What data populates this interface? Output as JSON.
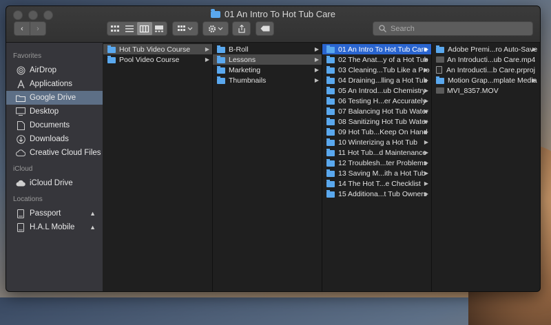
{
  "window": {
    "title": "01 An Intro To Hot Tub Care"
  },
  "toolbar": {
    "back_glyph": "‹",
    "forward_glyph": "›",
    "search_placeholder": "Search"
  },
  "sidebar": {
    "favorites_heading": "Favorites",
    "favorites": [
      {
        "label": "AirDrop",
        "icon": "airdrop-icon"
      },
      {
        "label": "Applications",
        "icon": "applications-icon"
      },
      {
        "label": "Google Drive",
        "icon": "folder-icon"
      },
      {
        "label": "Desktop",
        "icon": "desktop-icon"
      },
      {
        "label": "Documents",
        "icon": "documents-icon"
      },
      {
        "label": "Downloads",
        "icon": "downloads-icon"
      },
      {
        "label": "Creative Cloud Files",
        "icon": "creative-cloud-icon"
      }
    ],
    "icloud_heading": "iCloud",
    "icloud": [
      {
        "label": "iCloud Drive",
        "icon": "cloud-icon"
      }
    ],
    "locations_heading": "Locations",
    "locations": [
      {
        "label": "Passport",
        "icon": "drive-icon"
      },
      {
        "label": "H.A.L Mobile",
        "icon": "drive-icon"
      }
    ]
  },
  "columns": {
    "col1": [
      {
        "label": "Hot Tub Video Course"
      },
      {
        "label": "Pool Video Course"
      }
    ],
    "col2": [
      {
        "label": "B-Roll"
      },
      {
        "label": "Lessons"
      },
      {
        "label": "Marketing"
      },
      {
        "label": "Thumbnails"
      }
    ],
    "col3": [
      {
        "label": "01 An Intro To Hot Tub Care"
      },
      {
        "label": "02 The Anat...y of a Hot Tub"
      },
      {
        "label": "03 Cleaning...Tub Like a Pro"
      },
      {
        "label": "04 Draining...lling a Hot Tub"
      },
      {
        "label": "05 An Introd...ub Chemistry"
      },
      {
        "label": "06 Testing H...er Accurately"
      },
      {
        "label": "07 Balancing Hot Tub Water"
      },
      {
        "label": "08 Sanitizing Hot Tub Water"
      },
      {
        "label": "09 Hot Tub...Keep On Hand"
      },
      {
        "label": "10 Winterizing a Hot Tub"
      },
      {
        "label": "11 Hot Tub...d Maintenance"
      },
      {
        "label": "12 Troublesh...ter Problems"
      },
      {
        "label": "13 Saving M...ith a Hot Tub"
      },
      {
        "label": "14 The Hot T...e Checklist"
      },
      {
        "label": "15 Additiona...t Tub Owners"
      }
    ],
    "col4": [
      {
        "label": "Adobe Premi...ro Auto-Save",
        "kind": "folder"
      },
      {
        "label": "An Introducti...ub Care.mp4",
        "kind": "video"
      },
      {
        "label": "An Introducti...b Care.prproj",
        "kind": "project"
      },
      {
        "label": "Motion Grap...mplate Media",
        "kind": "folder"
      },
      {
        "label": "MVI_8357.MOV",
        "kind": "video"
      }
    ]
  }
}
